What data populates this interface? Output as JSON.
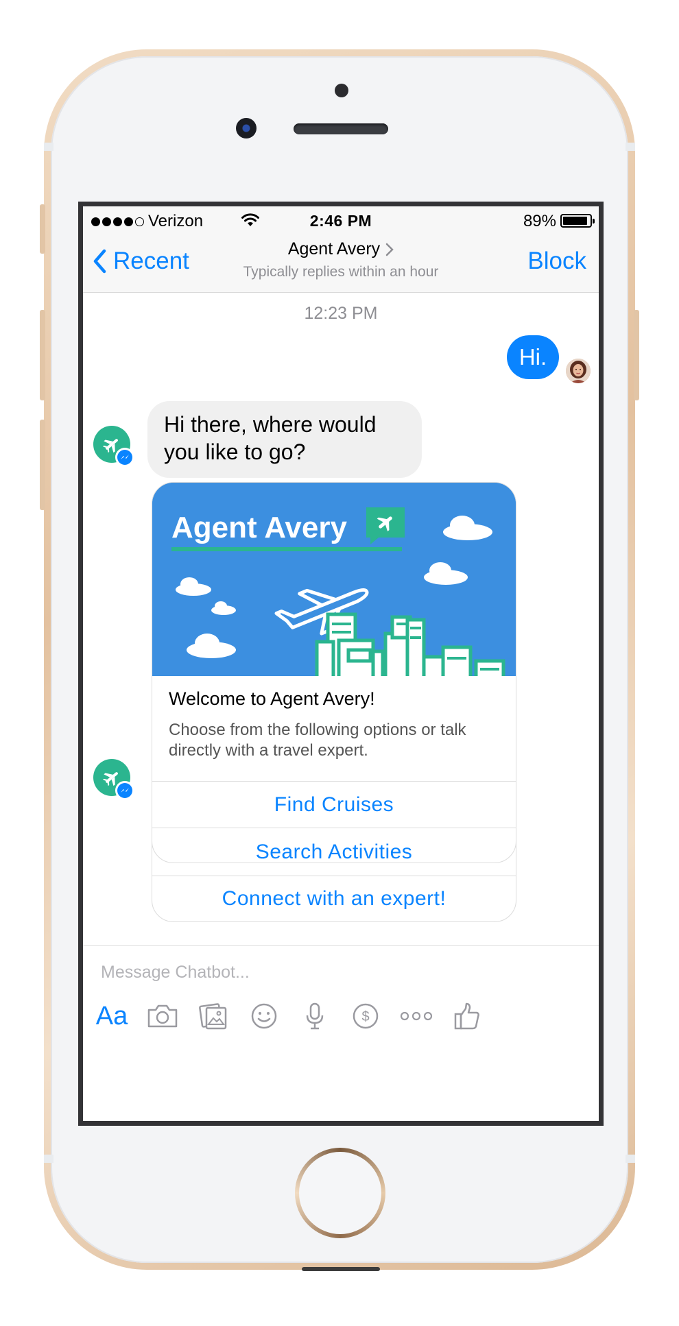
{
  "status_bar": {
    "carrier": "Verizon",
    "time": "2:46 PM",
    "battery": "89%"
  },
  "nav": {
    "back_label": "Recent",
    "title": "Agent Avery",
    "subtitle": "Typically replies within an hour",
    "block_label": "Block"
  },
  "chat": {
    "timestamp": "12:23 PM",
    "user_message": "Hi.",
    "bot_message": "Hi there, where would you like to go?"
  },
  "card": {
    "hero_brand": "Agent Avery",
    "title": "Welcome to Agent Avery!",
    "description": "Choose from the following options or talk directly with a travel expert.",
    "buttons": [
      "Find Cruises",
      "Search Activities",
      "Connect with an expert!"
    ]
  },
  "composer": {
    "placeholder": "Message Chatbot...",
    "value": "",
    "tools": {
      "text": "Aa",
      "icons": [
        "camera-icon",
        "photo-icon",
        "emoji-icon",
        "microphone-icon",
        "payment-icon",
        "more-icon",
        "like-icon"
      ]
    }
  },
  "colors": {
    "accent": "#0a84ff",
    "bot_avatar": "#2bb58f",
    "card_hero": "#3c8fe0",
    "phone_gold": "#e3c19f"
  }
}
